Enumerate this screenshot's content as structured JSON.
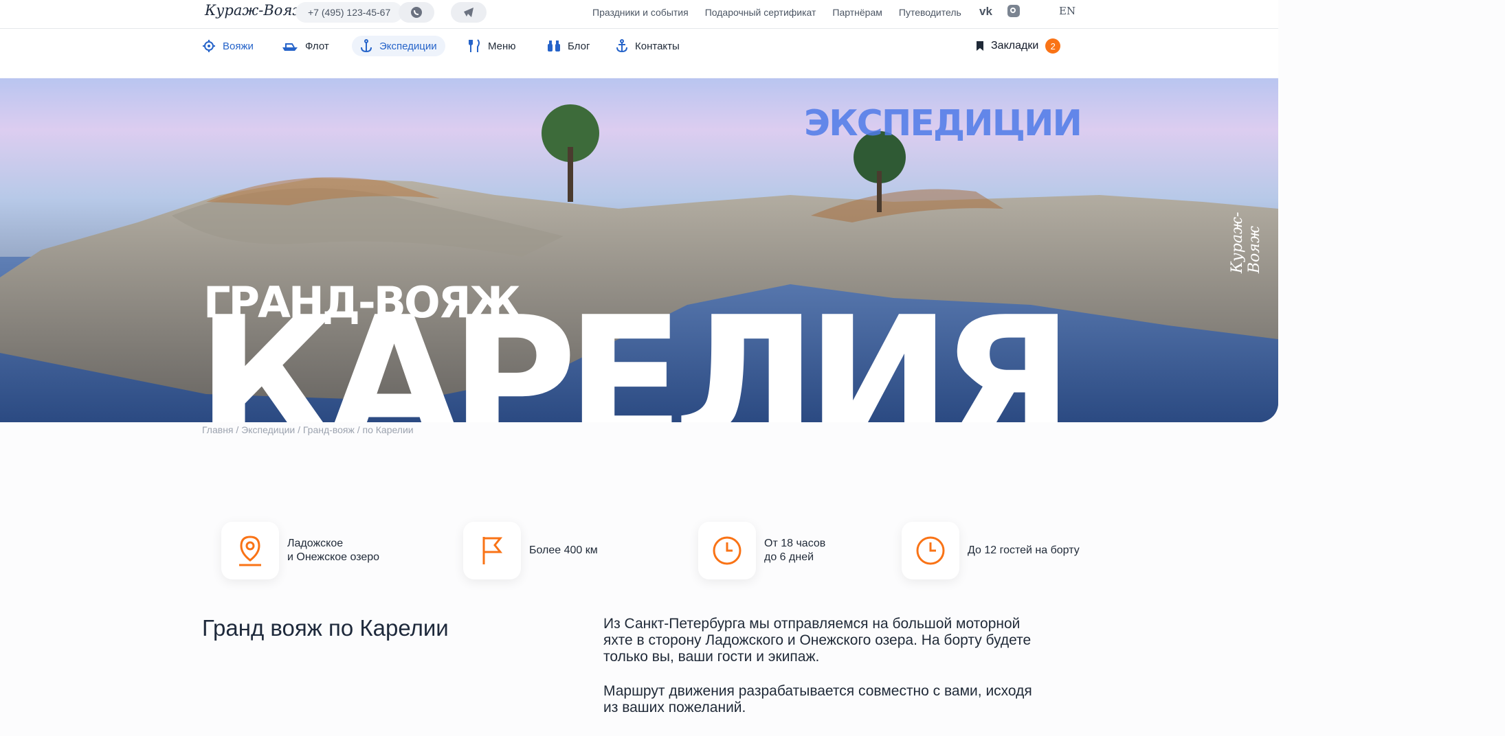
{
  "brand": {
    "logo": "Кураж-Вояж"
  },
  "topbar": {
    "phone": "+7 (495) 123-45-67",
    "links": [
      "Праздники и события",
      "Подарочный сертификат",
      "Партнёрам",
      "Путеводитель"
    ],
    "lang": "EN",
    "icons": [
      "whatsapp-icon",
      "telegram-icon",
      "vk-icon",
      "instagram-icon"
    ]
  },
  "nav": {
    "items": [
      {
        "label": "Вояжи",
        "icon": "ship-wheel-icon"
      },
      {
        "label": "Флот",
        "icon": "boat-icon"
      },
      {
        "label": "Экспедиции",
        "icon": "anchor-icon"
      },
      {
        "label": "Меню",
        "icon": "fork-knife-icon"
      },
      {
        "label": "Блог",
        "icon": "binoculars-icon"
      },
      {
        "label": "Контакты",
        "icon": "anchor-icon"
      }
    ],
    "bookmarks": {
      "label": "Закладки",
      "count": "2"
    }
  },
  "hero": {
    "kicker": "ЭКСПЕДИЦИИ",
    "subtitle": "ГРАНД-ВОЯЖ",
    "title": "КАРЕЛИЯ",
    "signature": "Кураж-Вояж"
  },
  "breadcrumb": "Главня / Экспедиции / Гранд-вояж / по Карелии",
  "features": [
    {
      "icon": "map-pin-icon",
      "lines": [
        "Ладожское",
        "и Онежское озеро"
      ]
    },
    {
      "icon": "flag-icon",
      "lines": [
        "Более 400 км"
      ]
    },
    {
      "icon": "clock-icon",
      "lines": [
        "От 18 часов",
        "до 6 дней"
      ]
    },
    {
      "icon": "clock-icon",
      "lines": [
        "До 12 гостей на борту"
      ]
    }
  ],
  "section": {
    "title": "Гранд вояж по Карелии",
    "paragraphs": [
      "Из Санкт-Петербурга мы отправляемся на большой моторной яхте в сторону Ладожского и Онежского озера. На борту будете только вы, ваши гости и экипаж.",
      "Маршрут движения разрабатывается совместно с вами, исходя из ваших пожеланий."
    ]
  },
  "colors": {
    "accent": "#2563c9",
    "orange": "#f97316"
  }
}
